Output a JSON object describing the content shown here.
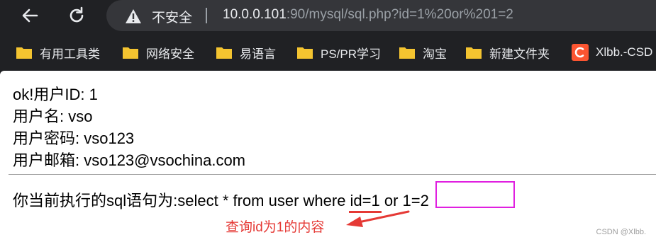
{
  "browser": {
    "insecure_label": "不安全",
    "url_host": "10.0.0.101",
    "url_path": ":90/mysql/sql.php?id=1%20or%201=2"
  },
  "bookmarks": [
    {
      "label": "有用工具类",
      "icon": "folder-icon"
    },
    {
      "label": "网络安全",
      "icon": "folder-icon"
    },
    {
      "label": "易语言",
      "icon": "folder-icon"
    },
    {
      "label": "PS/PR学习",
      "icon": "folder-icon"
    },
    {
      "label": "淘宝",
      "icon": "folder-icon"
    },
    {
      "label": "新建文件夹",
      "icon": "folder-icon"
    },
    {
      "label": "Xlbb.-CSD",
      "icon": "csdn-icon"
    }
  ],
  "result": {
    "line1": "ok!用户ID: 1",
    "line2": "用户名: vso",
    "line3": "用户密码: vso123",
    "line4": "用户邮箱: vso123@vsochina.com"
  },
  "sql": {
    "prefix": "你当前执行的sql语句为:select * from user where ",
    "id_part": "id=1",
    "tail": " or 1=2"
  },
  "annotation": {
    "note": "查询id为1的内容",
    "underline_color": "#e53935",
    "box_color": "#e020e0"
  },
  "watermark": "CSDN @Xlbb."
}
